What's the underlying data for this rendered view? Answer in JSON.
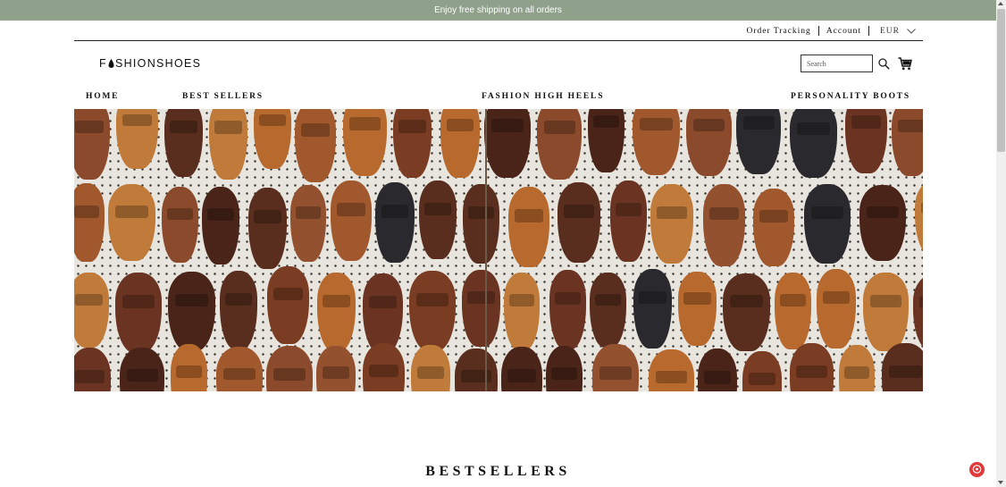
{
  "announcement": {
    "text": "Enjoy free shipping on all orders"
  },
  "header": {
    "order_tracking": "Order Tracking",
    "account": "Account",
    "currency": "EUR",
    "logo_pre": "F",
    "logo_post": "SHIONSHOES",
    "logo_logomark": "FASHIONSHOES",
    "search_placeholder": "Search"
  },
  "nav": {
    "items": [
      {
        "label": "HOME"
      },
      {
        "label": "BEST SELLERS"
      },
      {
        "label": "FASHION HIGH HEELS"
      },
      {
        "label": "PERSONALITY BOOTS"
      }
    ]
  },
  "hero": {
    "icon": "sandals-photo"
  },
  "sections": {
    "bestsellers_title": "BESTSELLERS"
  },
  "colors": {
    "announce_bg": "#8fa08b",
    "help_badge": "#e0393a",
    "text": "#111111"
  }
}
